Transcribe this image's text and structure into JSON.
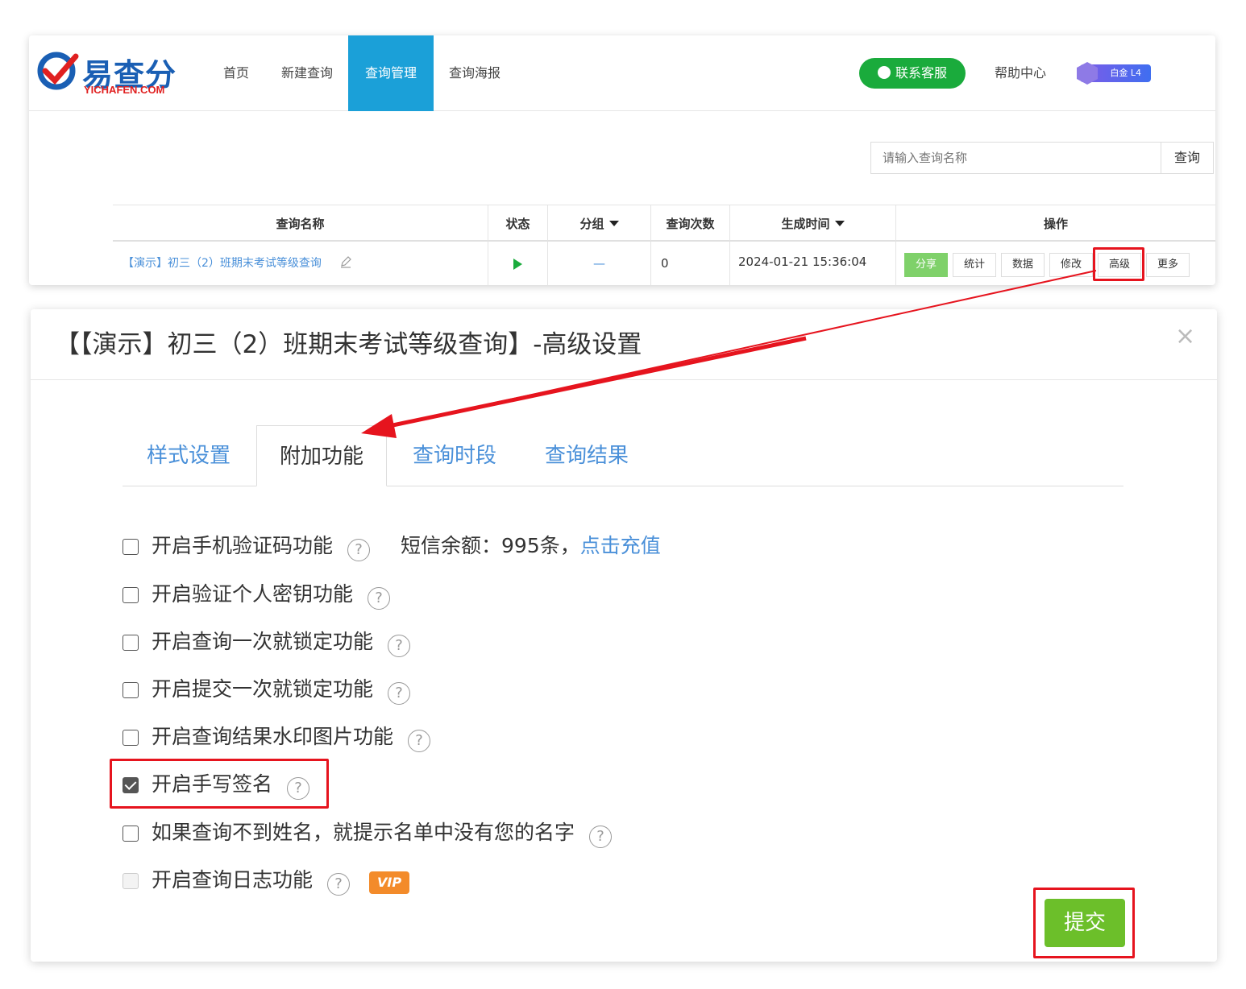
{
  "logo": {
    "text": "易查分",
    "sub": "YICHAFEN.COM"
  },
  "nav": {
    "items": [
      {
        "label": "首页"
      },
      {
        "label": "新建查询"
      },
      {
        "label": "查询管理"
      },
      {
        "label": "查询海报"
      }
    ],
    "customer_service": "联系客服",
    "help": "帮助中心",
    "badge": "白金 L4"
  },
  "search": {
    "placeholder": "请输入查询名称",
    "button": "查询"
  },
  "table": {
    "headers": [
      "查询名称",
      "状态",
      "分组",
      "查询次数",
      "生成时间",
      "操作"
    ],
    "row": {
      "name": "【演示】初三（2）班期末考试等级查询",
      "group": "—",
      "count": "0",
      "time": "2024-01-21 15:36:04"
    },
    "actions": [
      "分享",
      "统计",
      "数据",
      "修改",
      "高级",
      "更多"
    ]
  },
  "modal": {
    "title": "【【演示】初三（2）班期末考试等级查询】-高级设置",
    "close": "×",
    "tabs": [
      {
        "label": "样式设置"
      },
      {
        "label": "附加功能"
      },
      {
        "label": "查询时段"
      },
      {
        "label": "查询结果"
      }
    ],
    "options": [
      {
        "label": "开启手机验证码功能",
        "checked": false
      },
      {
        "label": "开启验证个人密钥功能",
        "checked": false
      },
      {
        "label": "开启查询一次就锁定功能",
        "checked": false
      },
      {
        "label": "开启提交一次就锁定功能",
        "checked": false
      },
      {
        "label": "开启查询结果水印图片功能",
        "checked": false
      },
      {
        "label": "开启手写签名",
        "checked": true
      },
      {
        "label": "如果查询不到姓名，就提示名单中没有您的名字",
        "checked": false
      },
      {
        "label": "开启查询日志功能",
        "checked": false,
        "disabled": true
      }
    ],
    "sms_text": "短信余额：995条，",
    "sms_link": "点击充值",
    "vip_tag": "VIP",
    "help_mark": "?",
    "submit": "提交"
  },
  "colors": {
    "accent": "#1ba0d8",
    "green": "#1aab3c",
    "submit": "#6cbf2a",
    "highlight": "#e6141e",
    "link": "#4a90d9"
  }
}
